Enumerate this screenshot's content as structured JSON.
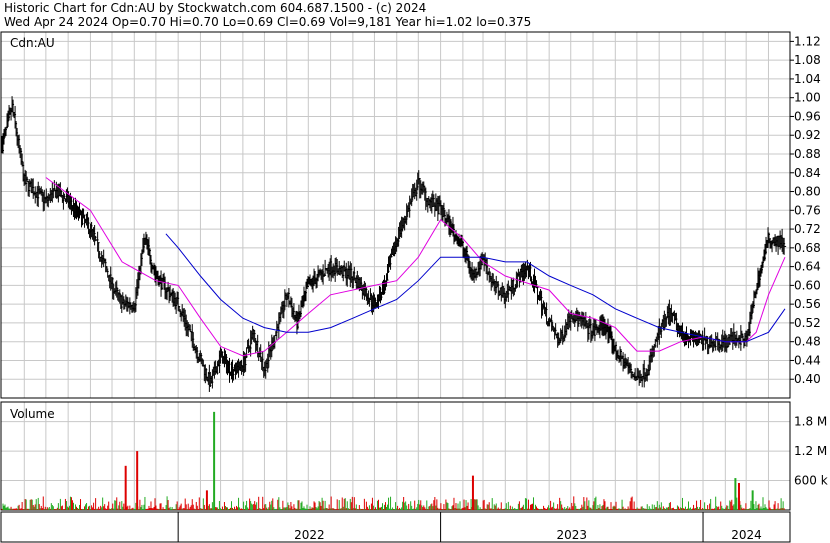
{
  "header": {
    "line1": "Historic Chart for Cdn:AU by Stockwatch.com 604.687.1500 - (c) 2024",
    "line2": "Wed Apr 24 2024   Op=0.70  Hi=0.70  Lo=0.69  Cl=0.69  Vol=9,181  Year hi=1.02  lo=0.375"
  },
  "colors": {
    "price_bar": "#000000",
    "ma_short": "#e000e0",
    "ma_long": "#0000cc",
    "vol_up": "#22aa22",
    "vol_down": "#dd0000",
    "grid": "#c8c8c8"
  },
  "chart_data": [
    {
      "type": "ohlc",
      "panel": "price",
      "label": "Cdn:AU",
      "ylim": [
        0.36,
        1.14
      ],
      "y_ticks": [
        "1.12",
        "1.08",
        "1.04",
        "1.00",
        "0.96",
        "0.92",
        "0.88",
        "0.84",
        "0.80",
        "0.76",
        "0.72",
        "0.68",
        "0.64",
        "0.60",
        "0.56",
        "0.52",
        "0.48",
        "0.44",
        "0.40"
      ],
      "x_ticks": [
        "2022",
        "2023",
        "2024"
      ],
      "grid": true,
      "series": [
        {
          "kind": "approx_close_path",
          "x": [
            "2021-05-01",
            "2021-05-15",
            "2021-06-01",
            "2021-07-01",
            "2021-07-15",
            "2021-08-01",
            "2021-09-01",
            "2021-10-01",
            "2021-10-15",
            "2021-11-01",
            "2021-11-15",
            "2021-12-01",
            "2022-01-01",
            "2022-02-01",
            "2022-02-15",
            "2022-03-01",
            "2022-03-15",
            "2022-04-01",
            "2022-04-15",
            "2022-05-01",
            "2022-06-01",
            "2022-06-15",
            "2022-07-01",
            "2022-07-15",
            "2022-08-01",
            "2022-09-01",
            "2022-10-01",
            "2022-10-15",
            "2022-11-01",
            "2022-12-01",
            "2022-12-15",
            "2023-01-01",
            "2023-02-01",
            "2023-02-15",
            "2023-03-01",
            "2023-03-15",
            "2023-04-01",
            "2023-05-01",
            "2023-06-01",
            "2023-06-15",
            "2023-07-01",
            "2023-08-01",
            "2023-08-15",
            "2023-09-01",
            "2023-10-01",
            "2023-10-15",
            "2023-11-01",
            "2023-11-15",
            "2023-12-01",
            "2024-01-01",
            "2024-02-01",
            "2024-02-15",
            "2024-03-01",
            "2024-03-15",
            "2024-04-01",
            "2024-04-24"
          ],
          "values": [
            0.9,
            0.98,
            0.82,
            0.78,
            0.8,
            0.78,
            0.72,
            0.6,
            0.56,
            0.56,
            0.7,
            0.62,
            0.56,
            0.44,
            0.39,
            0.45,
            0.42,
            0.43,
            0.5,
            0.42,
            0.58,
            0.52,
            0.6,
            0.62,
            0.64,
            0.62,
            0.56,
            0.6,
            0.7,
            0.82,
            0.78,
            0.76,
            0.68,
            0.62,
            0.66,
            0.6,
            0.58,
            0.64,
            0.52,
            0.48,
            0.54,
            0.5,
            0.52,
            0.46,
            0.4,
            0.42,
            0.5,
            0.54,
            0.5,
            0.48,
            0.48,
            0.49,
            0.48,
            0.6,
            0.7,
            0.69
          ]
        },
        {
          "kind": "moving_average_short",
          "x": [
            "2021-07-01",
            "2021-09-01",
            "2021-10-15",
            "2021-12-01",
            "2022-01-01",
            "2022-02-01",
            "2022-03-01",
            "2022-04-01",
            "2022-05-01",
            "2022-06-01",
            "2022-07-01",
            "2022-08-01",
            "2022-10-01",
            "2022-11-01",
            "2022-12-01",
            "2023-01-01",
            "2023-02-01",
            "2023-03-01",
            "2023-04-01",
            "2023-06-01",
            "2023-07-01",
            "2023-08-01",
            "2023-09-01",
            "2023-10-01",
            "2023-11-01",
            "2023-12-01",
            "2024-01-01",
            "2024-02-01",
            "2024-03-01",
            "2024-03-15",
            "2024-04-01",
            "2024-04-24"
          ],
          "values": [
            0.83,
            0.76,
            0.65,
            0.61,
            0.6,
            0.53,
            0.47,
            0.45,
            0.46,
            0.5,
            0.54,
            0.58,
            0.6,
            0.61,
            0.66,
            0.74,
            0.7,
            0.65,
            0.62,
            0.59,
            0.54,
            0.53,
            0.51,
            0.46,
            0.46,
            0.48,
            0.49,
            0.48,
            0.48,
            0.5,
            0.58,
            0.66
          ]
        },
        {
          "kind": "moving_average_long",
          "x": [
            "2021-12-15",
            "2022-01-01",
            "2022-02-01",
            "2022-03-01",
            "2022-04-01",
            "2022-05-01",
            "2022-06-01",
            "2022-07-01",
            "2022-08-01",
            "2022-09-01",
            "2022-10-01",
            "2022-11-01",
            "2022-12-01",
            "2023-01-01",
            "2023-02-01",
            "2023-03-01",
            "2023-04-01",
            "2023-05-01",
            "2023-06-01",
            "2023-07-01",
            "2023-08-01",
            "2023-09-01",
            "2023-10-01",
            "2023-11-01",
            "2023-12-01",
            "2024-01-01",
            "2024-02-01",
            "2024-03-01",
            "2024-04-01",
            "2024-04-24"
          ],
          "values": [
            0.71,
            0.68,
            0.62,
            0.57,
            0.53,
            0.51,
            0.5,
            0.5,
            0.51,
            0.53,
            0.55,
            0.57,
            0.61,
            0.66,
            0.66,
            0.66,
            0.65,
            0.65,
            0.62,
            0.6,
            0.58,
            0.55,
            0.53,
            0.51,
            0.5,
            0.49,
            0.48,
            0.48,
            0.5,
            0.55
          ]
        }
      ]
    },
    {
      "type": "bar",
      "panel": "volume",
      "label": "Volume",
      "y_ticks": [
        "1.8 M",
        "1.2 M",
        "600 k"
      ],
      "ylim": [
        0,
        2200000
      ],
      "bars_approx": "many small daily bars mostly below 300k",
      "spikes": [
        {
          "x": "2021-11-05",
          "value": 1200000,
          "dir": "down"
        },
        {
          "x": "2021-10-20",
          "value": 900000,
          "dir": "down"
        },
        {
          "x": "2022-02-10",
          "value": 400000,
          "dir": "down"
        },
        {
          "x": "2022-02-20",
          "value": 2000000,
          "dir": "up"
        },
        {
          "x": "2023-02-15",
          "value": 700000,
          "dir": "down"
        },
        {
          "x": "2024-02-15",
          "value": 650000,
          "dir": "up"
        },
        {
          "x": "2024-02-20",
          "value": 550000,
          "dir": "down"
        },
        {
          "x": "2024-03-10",
          "value": 400000,
          "dir": "up"
        }
      ]
    }
  ]
}
